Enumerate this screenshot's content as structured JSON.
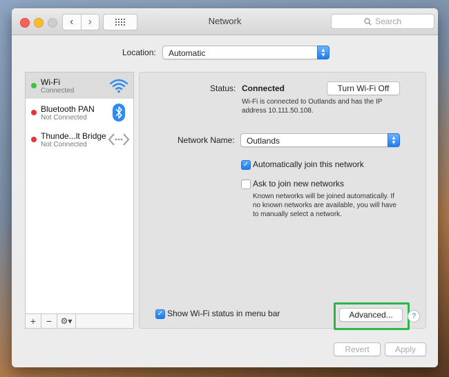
{
  "window": {
    "title": "Network",
    "search_placeholder": "Search"
  },
  "location": {
    "label": "Location:",
    "value": "Automatic"
  },
  "services": [
    {
      "name": "Wi-Fi",
      "status": "Connected",
      "dot_color": "#3fc23f",
      "icon": "wifi-icon"
    },
    {
      "name": "Bluetooth PAN",
      "status": "Not Connected",
      "dot_color": "#e63535",
      "icon": "bluetooth-icon"
    },
    {
      "name": "Thunde...lt Bridge",
      "status": "Not Connected",
      "dot_color": "#e63535",
      "icon": "thunderbolt-bridge-icon"
    }
  ],
  "sidebar_tools": {
    "add": "+",
    "remove": "−",
    "gear": "⚙▾"
  },
  "detail": {
    "status_label": "Status:",
    "status_value": "Connected",
    "turn_off_button": "Turn Wi-Fi Off",
    "status_desc_1": "Wi-Fi is connected to Outlands and has the IP",
    "status_desc_2": "address 10.111.50.108.",
    "network_name_label": "Network Name:",
    "network_name_value": "Outlands",
    "auto_join_label": "Automatically join this network",
    "auto_join_checked": true,
    "ask_join_label": "Ask to join new networks",
    "ask_join_checked": false,
    "ask_desc_1": "Known networks will be joined automatically. If",
    "ask_desc_2": "no known networks are available, you will have",
    "ask_desc_3": "to manually select a network.",
    "show_status_label": "Show Wi-Fi status in menu bar",
    "show_status_checked": true,
    "advanced_button": "Advanced...",
    "help": "?"
  },
  "footer": {
    "revert": "Revert",
    "apply": "Apply"
  },
  "colors": {
    "accent": "#1d7ef2",
    "highlight": "#2bb54a"
  }
}
